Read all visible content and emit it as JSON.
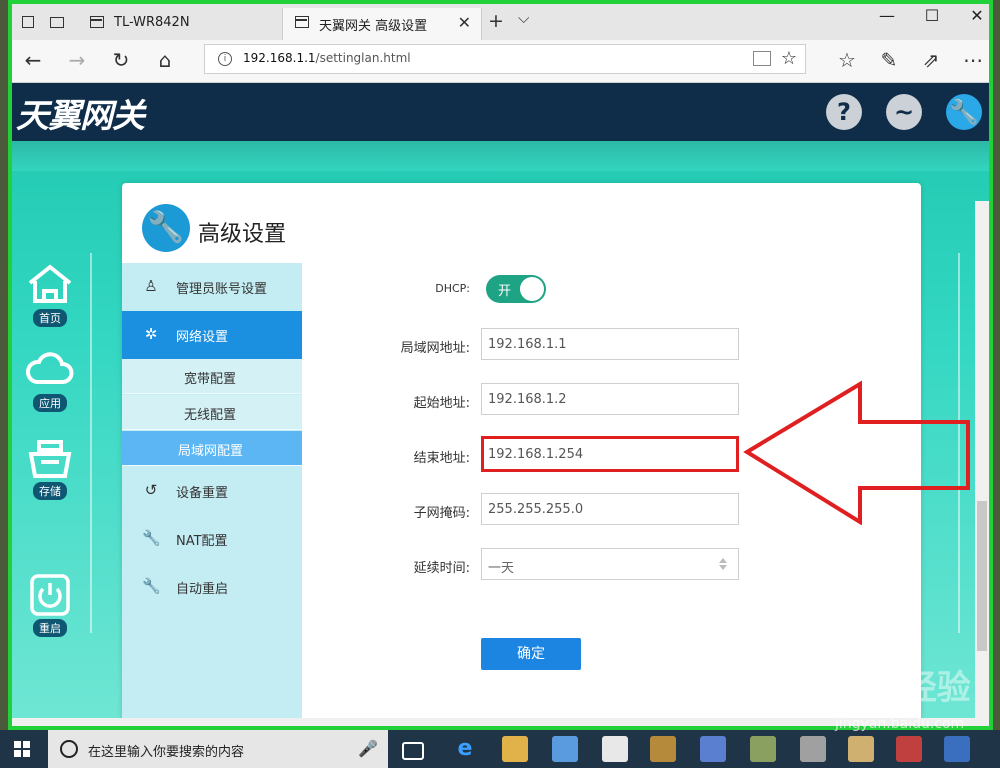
{
  "browser": {
    "tabs": [
      {
        "label": "TL-WR842N"
      },
      {
        "label": "天翼网关 高级设置"
      }
    ],
    "url_host": "192.168.1.1",
    "url_path": "/settinglan.html"
  },
  "header": {
    "logo": "天翼网关",
    "icons": [
      "help-icon",
      "status-icon",
      "settings-wrench-icon"
    ]
  },
  "left_nav": [
    {
      "label": "首页",
      "icon": "home-icon"
    },
    {
      "label": "应用",
      "icon": "cloud-icon"
    },
    {
      "label": "存储",
      "icon": "storage-icon"
    },
    {
      "label": "重启",
      "icon": "power-icon"
    }
  ],
  "card": {
    "title": "高级设置"
  },
  "menu": {
    "items": [
      {
        "label": "管理员账号设置",
        "icon": "user-icon"
      },
      {
        "label": "网络设置",
        "icon": "gear-icon"
      },
      {
        "label": "设备重置",
        "icon": "reset-icon"
      },
      {
        "label": "NAT配置",
        "icon": "wrench-icon"
      },
      {
        "label": "自动重启",
        "icon": "wrench-icon"
      }
    ],
    "subitems": [
      {
        "label": "宽带配置"
      },
      {
        "label": "无线配置"
      },
      {
        "label": "局域网配置"
      }
    ]
  },
  "form": {
    "dhcp_label": "DHCP:",
    "dhcp_state": "开",
    "lan_label": "局域网地址:",
    "lan_value": "192.168.1.1",
    "start_label": "起始地址:",
    "start_value": "192.168.1.2",
    "end_label": "结束地址:",
    "end_value": "192.168.1.254",
    "mask_label": "子网掩码:",
    "mask_value": "255.255.255.0",
    "lease_label": "延续时间:",
    "lease_value": "一天",
    "submit": "确定"
  },
  "taskbar": {
    "search_placeholder": "在这里输入你要搜索的内容"
  },
  "watermark": {
    "brand": "Bai du 经验",
    "url": "jingyan.baidu.com"
  },
  "colors": {
    "accent_blue": "#1b8fe0",
    "toggle_green": "#1fa385",
    "highlight_red": "#e02020",
    "window_border": "#22d13a"
  }
}
